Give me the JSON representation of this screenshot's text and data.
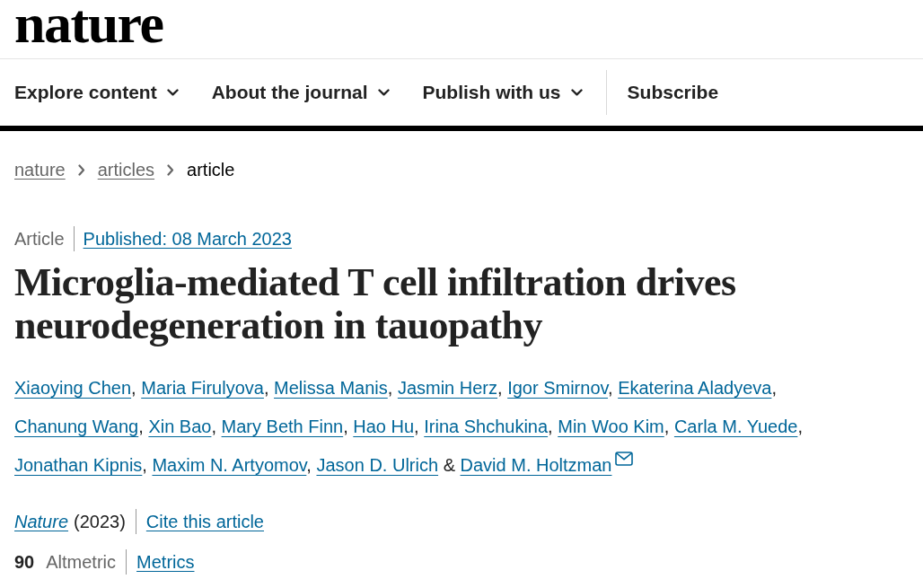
{
  "logo": "nature",
  "nav": [
    {
      "label": "Explore content",
      "kind": "dropdown"
    },
    {
      "label": "About the journal",
      "kind": "dropdown"
    },
    {
      "label": "Publish with us",
      "kind": "dropdown"
    },
    {
      "label": "Subscribe",
      "kind": "link"
    }
  ],
  "breadcrumbs": [
    {
      "label": "nature",
      "current": false
    },
    {
      "label": "articles",
      "current": false
    },
    {
      "label": "article",
      "current": true
    }
  ],
  "article": {
    "type": "Article",
    "published": "Published: 08 March 2023",
    "title": "Microglia-mediated T cell infiltration drives neurodegeneration in tauopathy",
    "authors": [
      {
        "name": "Xiaoying Chen",
        "separator": ",",
        "email": false
      },
      {
        "name": "Maria Firulyova",
        "separator": ",",
        "email": false
      },
      {
        "name": "Melissa Manis",
        "separator": ",",
        "email": false
      },
      {
        "name": "Jasmin Herz",
        "separator": ",",
        "email": false
      },
      {
        "name": "Igor Smirnov",
        "separator": ",",
        "email": false
      },
      {
        "name": "Ekaterina Aladyeva",
        "separator": ",",
        "email": false
      },
      {
        "name": "Chanung Wang",
        "separator": ",",
        "email": false
      },
      {
        "name": "Xin Bao",
        "separator": ",",
        "email": false
      },
      {
        "name": "Mary Beth Finn",
        "separator": ",",
        "email": false
      },
      {
        "name": "Hao Hu",
        "separator": ",",
        "email": false
      },
      {
        "name": "Irina Shchukina",
        "separator": ",",
        "email": false
      },
      {
        "name": "Min Woo Kim",
        "separator": ",",
        "email": false
      },
      {
        "name": "Carla M. Yuede",
        "separator": ",",
        "email": false
      },
      {
        "name": "Jonathan Kipnis",
        "separator": ",",
        "email": false
      },
      {
        "name": "Maxim N. Artyomov",
        "separator": ",",
        "email": false
      },
      {
        "name": "Jason D. Ulrich",
        "separator": "&",
        "email": false
      },
      {
        "name": "David M. Holtzman",
        "email": true
      }
    ],
    "journal": "Nature",
    "year": "(2023)",
    "cite_link": "Cite this article",
    "altmetric_score": "90",
    "altmetric_label": "Altmetric",
    "metrics_link": "Metrics"
  }
}
